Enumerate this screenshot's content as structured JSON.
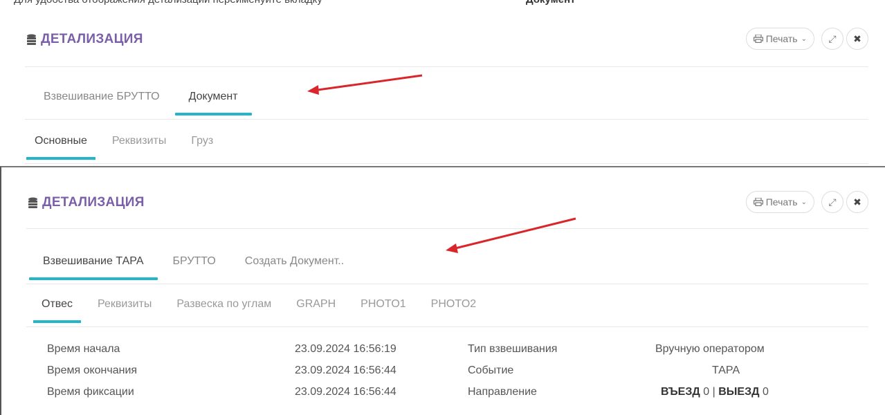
{
  "top_fragment": {
    "text": "Для удобства отображения детализации переименуйте вкладку",
    "bold": "Документ"
  },
  "panels": [
    {
      "title": "ДЕТАЛИЗАЦИЯ",
      "print_label": "Печать",
      "tabs": [
        {
          "label": "Взвешивание БРУТТО",
          "active": false
        },
        {
          "label": "Документ",
          "active": true
        }
      ],
      "sub_tabs": [
        {
          "label": "Основные",
          "active": true
        },
        {
          "label": "Реквизиты",
          "active": false
        },
        {
          "label": "Груз",
          "active": false
        }
      ]
    },
    {
      "title": "ДЕТАЛИЗАЦИЯ",
      "print_label": "Печать",
      "tabs": [
        {
          "label": "Взвешивание ТАРА",
          "active": true
        },
        {
          "label": "БРУТТО",
          "active": false
        },
        {
          "label": "Создать Документ..",
          "active": false
        }
      ],
      "sub_tabs": [
        {
          "label": "Отвес",
          "active": true
        },
        {
          "label": "Реквизиты",
          "active": false
        },
        {
          "label": "Развеска по углам",
          "active": false
        },
        {
          "label": "GRAPH",
          "active": false
        },
        {
          "label": "PHOTO1",
          "active": false
        },
        {
          "label": "PHOTO2",
          "active": false
        }
      ],
      "details": {
        "rows": [
          {
            "label": "Время начала",
            "value": "23.09.2024 16:56:19",
            "label2": "Тип взвешивания",
            "value2": "Вручную оператором"
          },
          {
            "label": "Время окончания",
            "value": "23.09.2024 16:56:44",
            "label2": "Событие",
            "value2": "ТАРА"
          },
          {
            "label": "Время фиксации",
            "value": "23.09.2024 16:56:44",
            "label2": "Направление",
            "value2": ""
          }
        ],
        "direction": {
          "in_label": "ВЪЕЗД",
          "in_count": "0",
          "separator": "|",
          "out_label": "ВЫЕЗД",
          "out_count": "0"
        }
      }
    }
  ],
  "colors": {
    "title": "#7a5fa8",
    "tab_underline": "#23b5c9",
    "arrow": "#d9262b"
  },
  "icons": {
    "title_icon": "database-icon",
    "print_icon": "printer-icon",
    "expand_icon": "expand-icon",
    "close_icon": "close-icon",
    "caret_icon": "chevron-down-icon"
  }
}
